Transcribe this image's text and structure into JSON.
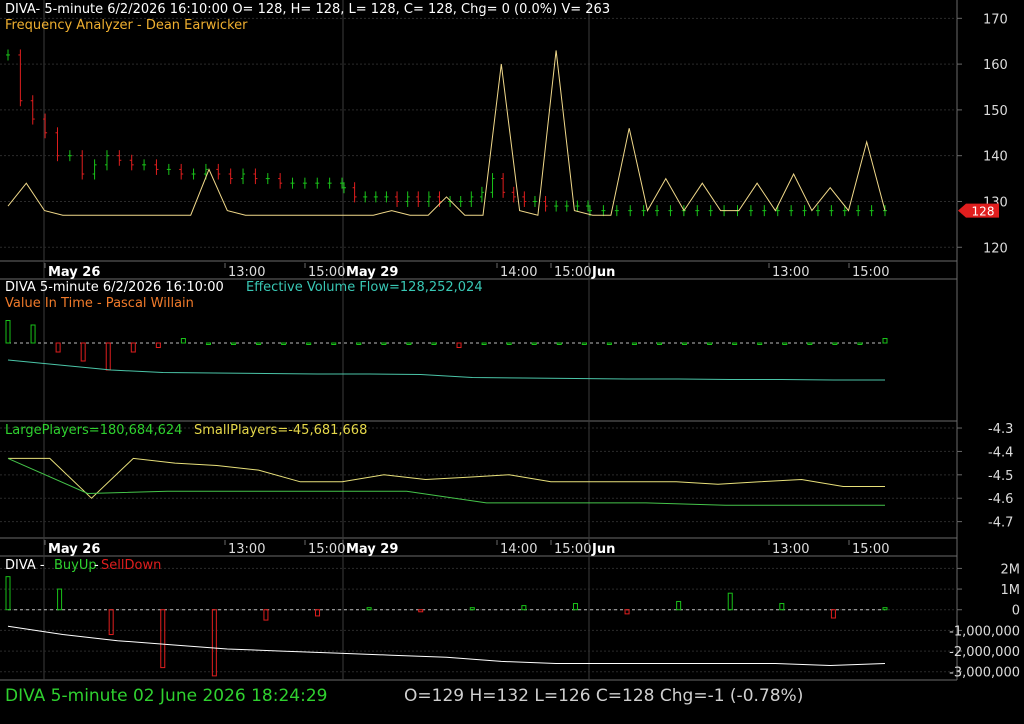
{
  "colors": {
    "background": "#000000",
    "grid": "#2b2b2b",
    "divider": "#6a6a6a",
    "up": "#19c219",
    "down": "#e01e1e",
    "freq_line": "#f1d98a",
    "green_text": "#2fd12f",
    "yellow_text": "#e6d84a",
    "orange_text": "#f07a2a",
    "teal_text": "#39c8b5",
    "evf_line": "#4bc5a8",
    "small_players_line": "#e8e07a",
    "large_players_line": "#45c44a",
    "buyup_line": "#ffffff",
    "price_marker": "#e01e1e"
  },
  "panel1": {
    "header": "DIVA- 5-minute 6/2/2026 16:10:00 O= 128, H= 128, L= 128, C= 128, Chg= 0 (0.0%) V= 263",
    "indicator": "Frequency Analyzer - Dean Earwicker",
    "price_marker": "128"
  },
  "date_axis_1": [
    "May 26",
    "13:00",
    "15:00",
    "May 29",
    "14:00",
    "15:00",
    "Jun",
    "13:00",
    "15:00"
  ],
  "panel2": {
    "header_left": "DIVA 5-minute  6/2/2026 16:10:00",
    "header_right": "Effective Volume Flow=128,252,024",
    "indicator": "Value In Time - Pascal Willain"
  },
  "panel3": {
    "large_players": "LargePlayers=180,684,624",
    "small_players": "SmallPlayers=-45,681,668"
  },
  "date_axis_2": [
    "May 26",
    "13:00",
    "15:00",
    "May 29",
    "14:00",
    "15:00",
    "Jun",
    "13:00",
    "15:00"
  ],
  "panel4": {
    "symbol": "DIVA -",
    "buy_up": "BuyUp",
    "separator": "-",
    "sell_down": "SellDown"
  },
  "footer": {
    "symbol_time": "DIVA  5-minute   02 June 2026 18:24:29",
    "ohlc": "O=129  H=132  L=126  C=128  Chg=-1 (-0.78%)"
  },
  "chart_data": [
    {
      "type": "line",
      "title": "DIVA 5-minute price with Frequency Analyzer",
      "x": [
        "May 26",
        "13:00",
        "15:00",
        "May 29",
        "14:00",
        "15:00",
        "Jun",
        "13:00",
        "15:00"
      ],
      "y_axis_ticks": [
        120,
        130,
        140,
        150,
        160,
        170
      ],
      "ylim": [
        117,
        174
      ],
      "grid": true,
      "price_bars": {
        "segments": [
          {
            "values": [
              162,
              152,
              148,
              145,
              140,
              140,
              136,
              138,
              140,
              139,
              138,
              138,
              137,
              137,
              136,
              136,
              137,
              136,
              135,
              136,
              135,
              135,
              134,
              134,
              134,
              134,
              134,
              134
            ]
          },
          {
            "values": [
              133,
              131,
              131,
              131,
              131,
              130,
              131,
              130,
              131,
              130,
              130,
              130,
              131,
              132,
              135,
              132,
              131,
              130,
              130,
              129,
              129,
              129,
              129,
              129
            ]
          },
          {
            "values": [
              128,
              128,
              128,
              128,
              128,
              128,
              128,
              128,
              128,
              128,
              128,
              128,
              128,
              128,
              128,
              128,
              128,
              128,
              128,
              128,
              128,
              128,
              128
            ]
          }
        ]
      },
      "frequency_analyzer": [
        129,
        134,
        128,
        127,
        127,
        127,
        127,
        127,
        127,
        127,
        127,
        137,
        128,
        127,
        127,
        127,
        127,
        127,
        127,
        127,
        127,
        128,
        127,
        127,
        131,
        127,
        127,
        160,
        128,
        127,
        163,
        128,
        127,
        127,
        146,
        128,
        135,
        128,
        134,
        128,
        128,
        134,
        128,
        136,
        128,
        133,
        128,
        143,
        128
      ]
    },
    {
      "type": "bar",
      "title": "Value In Time / Effective Volume Flow",
      "bars": [
        5,
        4,
        -2,
        -4,
        -6,
        -2,
        -1,
        1,
        0,
        0,
        0,
        0,
        0,
        0,
        0,
        0,
        0,
        0,
        -1,
        0,
        0,
        0,
        0,
        0,
        0,
        0,
        0,
        0,
        0,
        0,
        0,
        0,
        0,
        0,
        0,
        1
      ],
      "evf_line": [
        10,
        9,
        8,
        7.5,
        7.4,
        7.3,
        7.2,
        7.2,
        7.1,
        6.5,
        6.4,
        6.3,
        6.2,
        6.2,
        6.1,
        6.1,
        6.0,
        6.0
      ]
    },
    {
      "type": "line",
      "title": "LargePlayers / SmallPlayers",
      "y_axis_ticks": [
        -4.3,
        -4.4,
        -4.5,
        -4.6,
        -4.7
      ],
      "ylim": [
        -4.77,
        -4.27
      ],
      "series": [
        {
          "name": "SmallPlayers",
          "values": [
            -4.43,
            -4.43,
            -4.6,
            -4.43,
            -4.45,
            -4.46,
            -4.48,
            -4.53,
            -4.53,
            -4.5,
            -4.52,
            -4.51,
            -4.5,
            -4.53,
            -4.53,
            -4.53,
            -4.53,
            -4.54,
            -4.53,
            -4.52,
            -4.55,
            -4.55
          ]
        },
        {
          "name": "LargePlayers",
          "values": [
            -4.43,
            -4.58,
            -4.57,
            -4.57,
            -4.57,
            -4.57,
            -4.62,
            -4.62,
            -4.62,
            -4.63,
            -4.63,
            -4.63
          ]
        }
      ]
    },
    {
      "type": "bar",
      "title": "DIVA - BuyUp-SellDown",
      "y_axis_ticks": [
        "2M",
        "1M",
        "0",
        "-1,000,000",
        "-2,000,000",
        "-3,000,000"
      ],
      "ylim": [
        -3400000,
        2600000
      ],
      "bars": [
        1.6,
        1.0,
        -1.2,
        -2.8,
        -3.2,
        -0.5,
        -0.3,
        0.1,
        -0.1,
        0.1,
        0.2,
        0.3,
        -0.2,
        0.4,
        0.8,
        0.3,
        -0.4,
        0.1
      ],
      "line": [
        -0.8,
        -1.2,
        -1.5,
        -1.7,
        -1.9,
        -2.0,
        -2.1,
        -2.2,
        -2.3,
        -2.5,
        -2.6,
        -2.6,
        -2.6,
        -2.6,
        -2.6,
        -2.7,
        -2.6
      ]
    }
  ]
}
